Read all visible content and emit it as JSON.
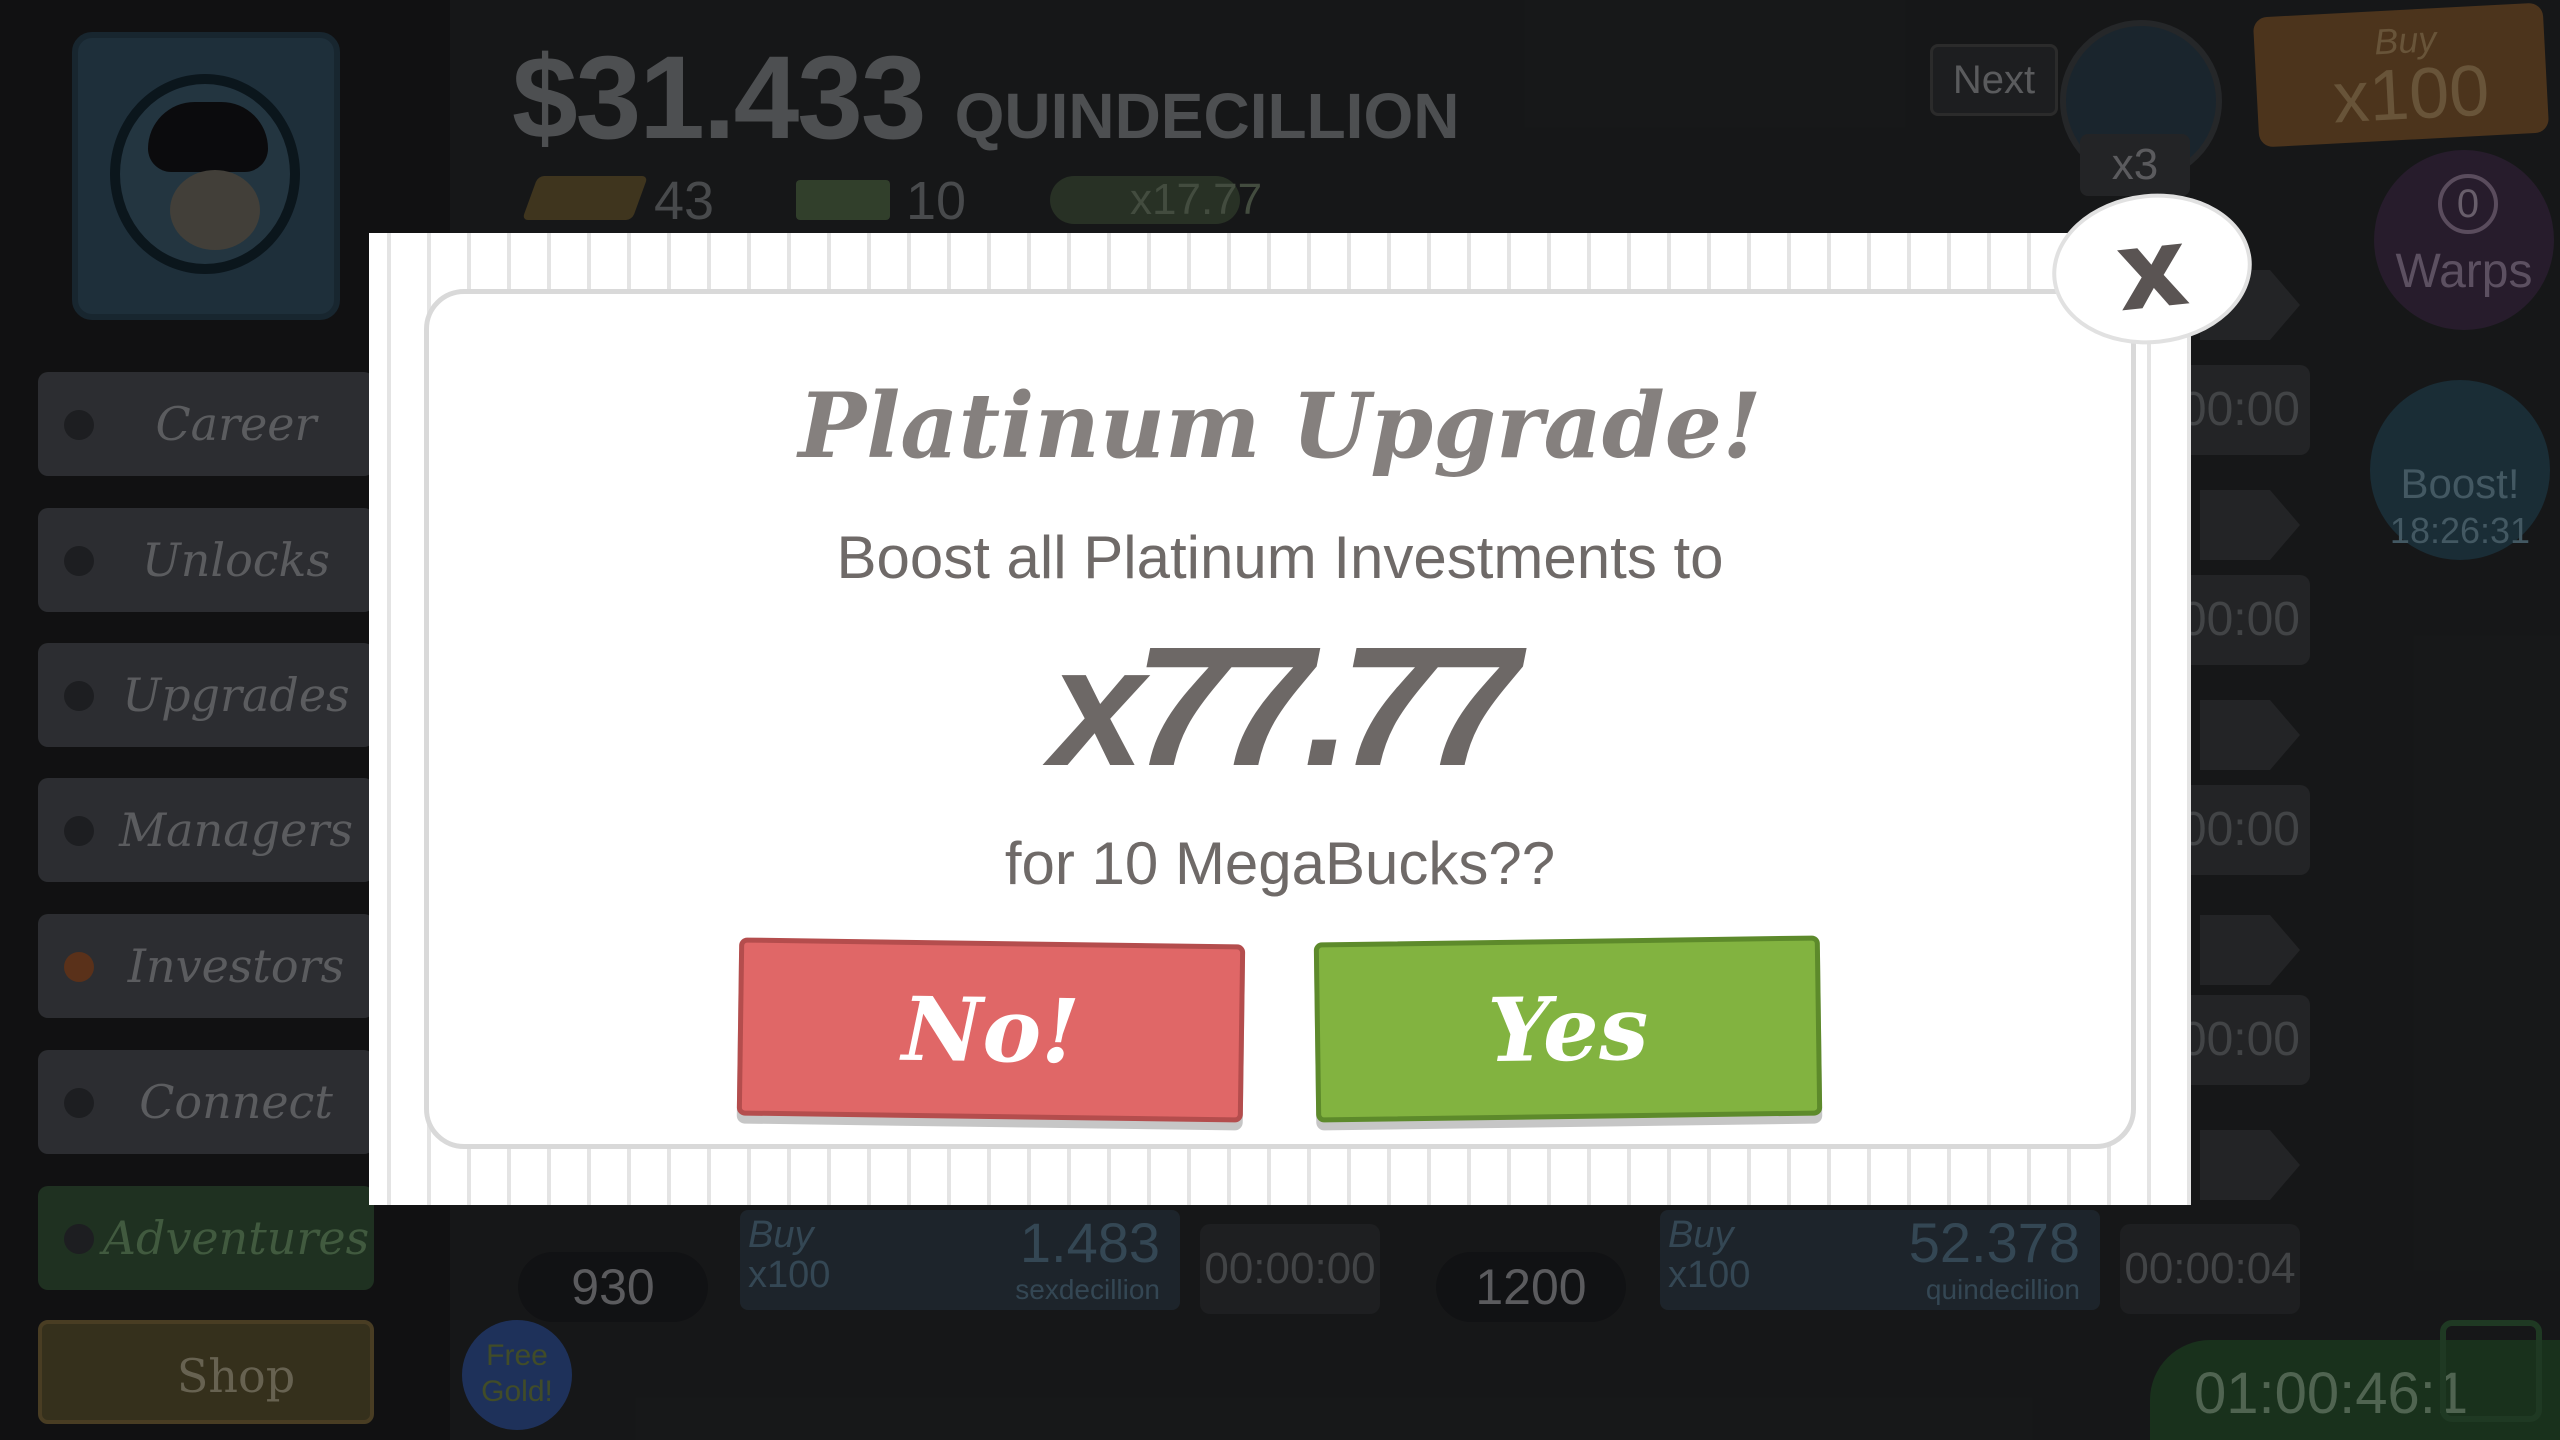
{
  "header": {
    "money_symbol": "$",
    "money_value": "31.433",
    "money_unit": "QUINDECILLION",
    "gold_count": "43",
    "megabucks_count": "10",
    "megabucks_multiplier": "x17.77",
    "next_label": "Next",
    "bank_multiplier": "x3",
    "buy_label": "Buy",
    "buy_amount": "x100"
  },
  "side_widgets": {
    "warps_count": "0",
    "warps_label": "Warps",
    "boost_label": "Boost!",
    "boost_timer": "18:26:31"
  },
  "sidebar": {
    "items": [
      {
        "label": "Career"
      },
      {
        "label": "Unlocks"
      },
      {
        "label": "Upgrades"
      },
      {
        "label": "Managers"
      },
      {
        "label": "Investors"
      },
      {
        "label": "Connect"
      },
      {
        "label": "Adventures"
      },
      {
        "label": "Shop"
      }
    ]
  },
  "row_timers": [
    "00:00",
    "00:00",
    "00:00",
    "00:00"
  ],
  "bottom_rows": [
    {
      "count": "930",
      "buy": "Buy",
      "buy_amount": "x100",
      "value": "1.483",
      "unit": "sexdecillion",
      "time": "00:00:00"
    },
    {
      "count": "1200",
      "buy": "Buy",
      "buy_amount": "x100",
      "value": "52.378",
      "unit": "quindecillion",
      "time": "00:00:04"
    }
  ],
  "free_gold_label": "Free Gold!",
  "bottom_timer": "01:00:46:1",
  "modal": {
    "title": "Platinum Upgrade!",
    "line1": "Boost all Platinum Investments to",
    "multiplier": "x77.77",
    "line2": "for 10 MegaBucks??",
    "no_label": "No!",
    "yes_label": "Yes",
    "close_label": "x"
  },
  "colors": {
    "no_button": "#e06767",
    "yes_button": "#82b340",
    "modal_bg": "#ffffff",
    "text": "#6f6a68"
  }
}
